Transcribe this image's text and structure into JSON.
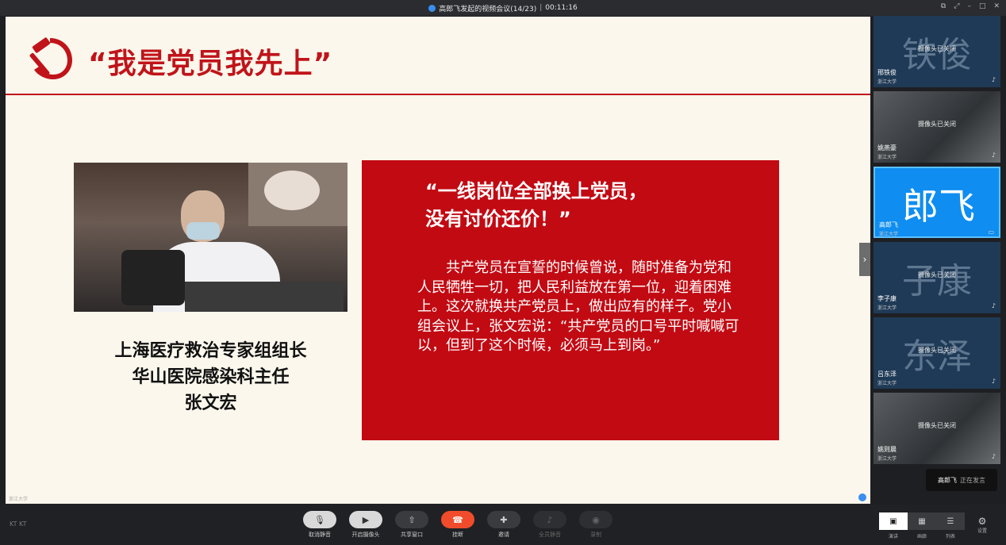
{
  "window": {
    "title": "高郎飞发起的视频会议(14/23)",
    "separator": "|",
    "timer": "00:11:16"
  },
  "slide": {
    "title": "“我是党员我先上”",
    "caption": [
      "上海医疗救治专家组组长",
      "华山医院感染科主任",
      "张文宏"
    ],
    "quote": "“一线岗位全部换上党员，\n没有讨价还价！”",
    "body": "　　共产党员在宣誓的时候曾说，随时准备为党和人民牺牲一切，把人民利益放在第一位，迎着困难上。这次就换共产党员上，做出应有的样子。党小组会议上，张文宏说：“共产党员的口号平时喊喊可以，但到了这个时候，必须马上到岗。”",
    "footer_tag": "浙江大学"
  },
  "participants": [
    {
      "big": "铁俊",
      "status": "摄像头已关闭",
      "name": "邢铁俊",
      "org": "浙江大学",
      "photo": false,
      "active": false
    },
    {
      "big": "",
      "status": "摄像头已关闭",
      "name": "姚燕豪",
      "org": "浙江大学",
      "photo": true,
      "active": false
    },
    {
      "big": "郎飞",
      "status": "",
      "name": "高郎飞",
      "org": "浙江大学",
      "photo": false,
      "active": true
    },
    {
      "big": "子康",
      "status": "摄像头已关闭",
      "name": "李子康",
      "org": "浙江大学",
      "photo": false,
      "active": false
    },
    {
      "big": "东泽",
      "status": "摄像头已关闭",
      "name": "吕东泽",
      "org": "浙江大学",
      "photo": false,
      "active": false
    },
    {
      "big": "",
      "status": "摄像头已关闭",
      "name": "姚则晨",
      "org": "浙江大学",
      "photo": true,
      "active": false
    }
  ],
  "speaking": {
    "name": "高郎飞",
    "text": "正在发言"
  },
  "toolbar": {
    "logo": "KT KT",
    "buttons": [
      {
        "label": "取消静音",
        "icon": "mic-icon"
      },
      {
        "label": "开启摄像头",
        "icon": "camera-icon"
      },
      {
        "label": "共享窗口",
        "icon": "share-icon"
      },
      {
        "label": "挂断",
        "icon": "hangup-icon"
      },
      {
        "label": "邀请",
        "icon": "invite-icon"
      },
      {
        "label": "全员静音",
        "icon": "mute-all-icon"
      },
      {
        "label": "录制",
        "icon": "record-icon"
      }
    ],
    "views": [
      "演讲",
      "画廊",
      "列表"
    ],
    "settings": "设置"
  }
}
